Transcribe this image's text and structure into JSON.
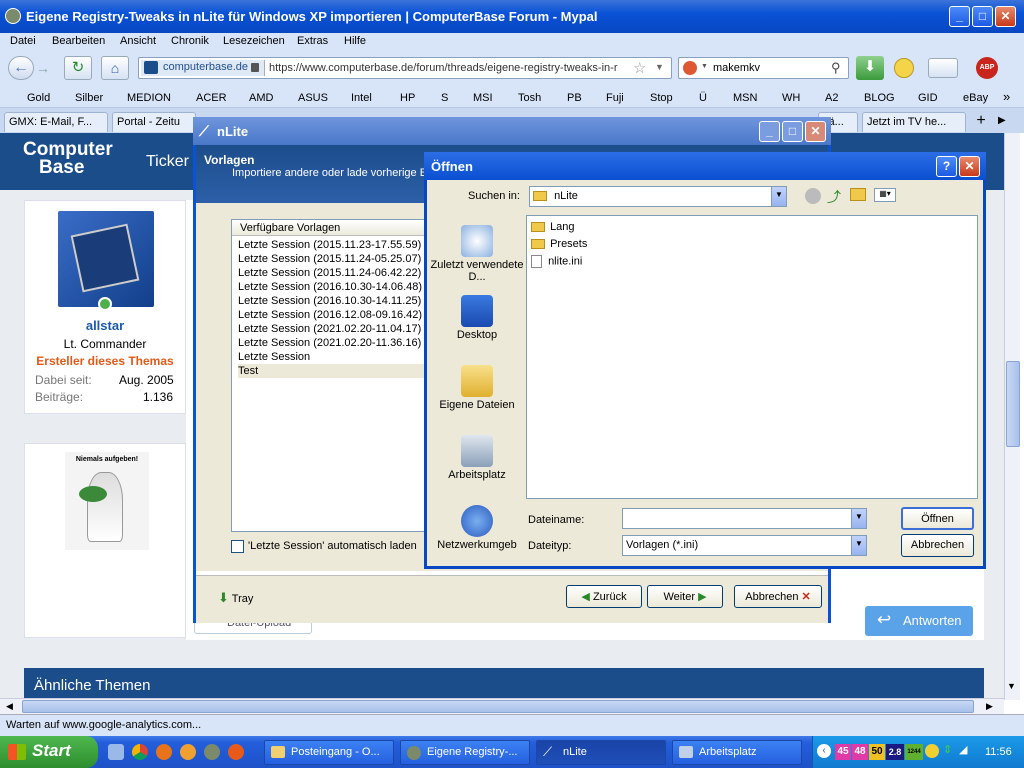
{
  "browser": {
    "title": "Eigene Registry-Tweaks in nLite für Windows XP importieren | ComputerBase Forum - Mypal",
    "menu": [
      "Datei",
      "Bearbeiten",
      "Ansicht",
      "Chronik",
      "Lesezeichen",
      "Extras",
      "Hilfe"
    ],
    "site_badge": "computerbase.de",
    "url": "https://www.computerbase.de/forum/threads/eigene-registry-tweaks-in-r",
    "search_value": "makemkv",
    "bookmarks": [
      "Gold",
      "Silber",
      "MEDION",
      "ACER",
      "AMD",
      "ASUS",
      "Intel",
      "HP",
      "S",
      "MSI",
      "Tosh",
      "PB",
      "Fuji",
      "Stop",
      "Ü",
      "MSN",
      "WH",
      "A2",
      "BLOG",
      "GID",
      "eBay"
    ],
    "tabs": [
      "GMX: E-Mail, F...",
      "Portal - Zeitu",
      "itä...",
      "Jetzt im TV he..."
    ],
    "status": "Warten auf www.google-analytics.com..."
  },
  "forum": {
    "logo_top": "Computer",
    "logo_bottom": "Base",
    "nav_item": "Ticker",
    "user": {
      "name": "allstar",
      "rank": "Lt. Commander",
      "badge": "Ersteller dieses Themas",
      "joined_label": "Dabei seit:",
      "joined_value": "Aug. 2005",
      "posts_label": "Beiträge:",
      "posts_value": "1.136",
      "avatar_caption": "Niemals aufgeben!"
    },
    "upload_label": "Datei-Upload",
    "reply_label": "Antworten",
    "similar_title": "Ähnliche Themen"
  },
  "nlite": {
    "title": "nLite",
    "section_title": "Vorlagen",
    "section_desc": "Importiere andere oder lade vorherige Ein",
    "list_header": "Verfügbare Vorlagen",
    "items": [
      "Letzte Session (2015.11.23-17.55.59)",
      "Letzte Session (2015.11.24-05.25.07)",
      "Letzte Session (2015.11.24-06.42.22)",
      "Letzte Session (2016.10.30-14.06.48)",
      "Letzte Session (2016.10.30-14.11.25)",
      "Letzte Session (2016.12.08-09.16.42)",
      "Letzte Session (2021.02.20-11.04.17)",
      "Letzte Session (2021.02.20-11.36.16)",
      "Letzte Session",
      "Test"
    ],
    "auto_load": "'Letzte Session' automatisch laden",
    "tray": "Tray",
    "back": "Zurück",
    "next": "Weiter",
    "cancel": "Abbrechen"
  },
  "open_dialog": {
    "title": "Öffnen",
    "look_in_label": "Suchen in:",
    "look_in_value": "nLite",
    "places": [
      "Zuletzt verwendete D...",
      "Desktop",
      "Eigene Dateien",
      "Arbeitsplatz",
      "Netzwerkumgeb"
    ],
    "files": [
      "Lang",
      "Presets",
      "nlite.ini"
    ],
    "filename_label": "Dateiname:",
    "filename_value": "",
    "filetype_label": "Dateityp:",
    "filetype_value": "Vorlagen (*.ini)",
    "open_btn": "Öffnen",
    "cancel_btn": "Abbrechen"
  },
  "taskbar": {
    "start": "Start",
    "tasks": [
      "Posteingang - O...",
      "Eigene Registry-...",
      "nLite",
      "Arbeitsplatz"
    ],
    "tray_numbers": [
      "45",
      "48",
      "50",
      "2.8",
      "1244"
    ],
    "clock": "11:56"
  }
}
